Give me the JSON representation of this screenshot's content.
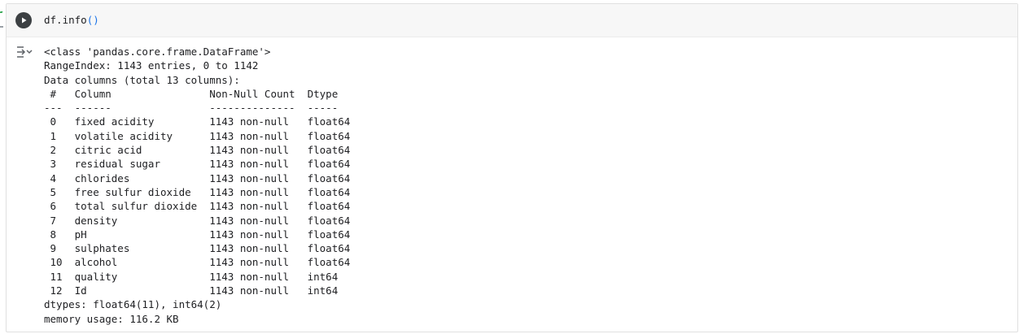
{
  "cell": {
    "code": "df.info",
    "code_parens": "()"
  },
  "output": {
    "lines": [
      "<class 'pandas.core.frame.DataFrame'>",
      "RangeIndex: 1143 entries, 0 to 1142",
      "Data columns (total 13 columns):",
      " #   Column                Non-Null Count  Dtype  ",
      "---  ------                --------------  -----  ",
      " 0   fixed acidity         1143 non-null   float64",
      " 1   volatile acidity      1143 non-null   float64",
      " 2   citric acid           1143 non-null   float64",
      " 3   residual sugar        1143 non-null   float64",
      " 4   chlorides             1143 non-null   float64",
      " 5   free sulfur dioxide   1143 non-null   float64",
      " 6   total sulfur dioxide  1143 non-null   float64",
      " 7   density               1143 non-null   float64",
      " 8   pH                    1143 non-null   float64",
      " 9   sulphates             1143 non-null   float64",
      " 10  alcohol               1143 non-null   float64",
      " 11  quality               1143 non-null   int64  ",
      " 12  Id                    1143 non-null   int64  ",
      "dtypes: float64(11), int64(2)",
      "memory usage: 116.2 KB"
    ]
  },
  "icons": {
    "run": "play-icon",
    "output_toggle": "output-toggle-icon"
  },
  "colors": {
    "code_background": "#f7f7f7",
    "run_button": "#3c4043",
    "paren": "#1a73e8",
    "text": "#202124"
  }
}
